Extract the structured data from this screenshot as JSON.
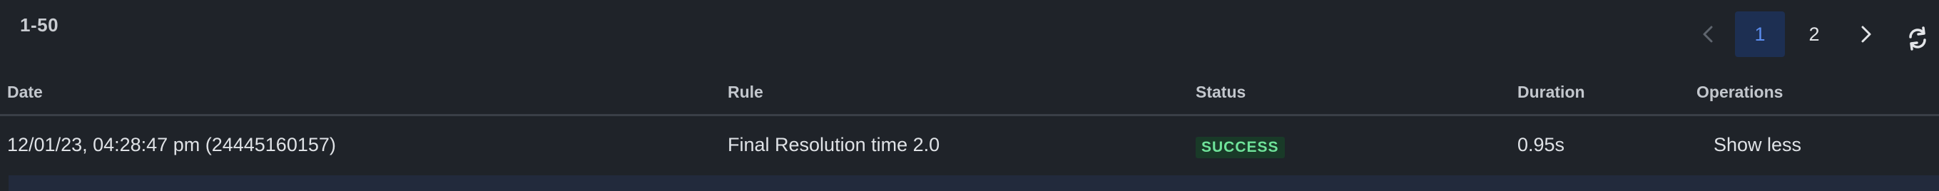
{
  "pagination": {
    "range": "1-50",
    "prev_label": "‹",
    "next_label": "›",
    "pages": [
      "1",
      "2"
    ],
    "current_page": "1"
  },
  "table": {
    "headers": {
      "date": "Date",
      "rule": "Rule",
      "status": "Status",
      "duration": "Duration",
      "operations": "Operations"
    },
    "rows": [
      {
        "date": "12/01/23, 04:28:47 pm (24445160157)",
        "rule": "Final Resolution time 2.0",
        "status": "SUCCESS",
        "duration": "0.95s",
        "operation": "Show less"
      }
    ]
  },
  "colors": {
    "background": "#1f2329",
    "active_page_bg": "#1d2f52",
    "active_page_text": "#5b8def",
    "success_bg": "#193a28",
    "success_text": "#6fe39a"
  },
  "icons": {
    "prev": "chevron-left-icon",
    "next": "chevron-right-icon",
    "refresh": "refresh-icon"
  }
}
